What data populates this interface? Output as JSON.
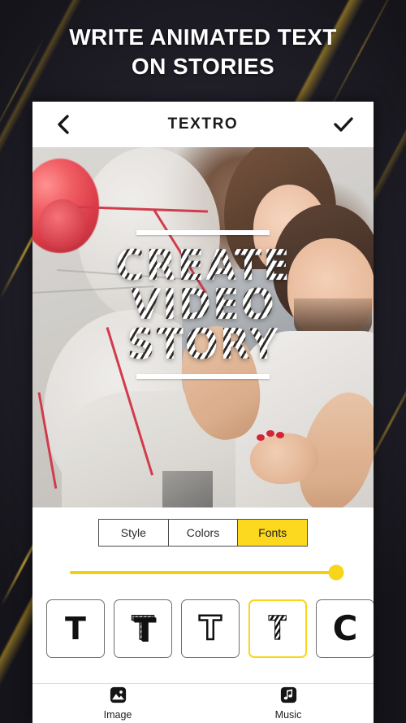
{
  "promo": {
    "headline_line1": "WRITE ANIMATED TEXT",
    "headline_line2": "ON STORIES",
    "background_color": "#1b1921",
    "accent_color": "#e1b937"
  },
  "appbar": {
    "back_icon": "chevron-left-icon",
    "title": "TEXTRO",
    "confirm_icon": "check-icon"
  },
  "canvas": {
    "overlay_line1": "CREATE",
    "overlay_line2": "VIDEO",
    "overlay_line3": "STORY",
    "divider_top": "horizontal-rule",
    "divider_bottom": "horizontal-rule",
    "photo_description": "couple with balloons"
  },
  "controls": {
    "tabs": [
      {
        "label": "Style",
        "active": false
      },
      {
        "label": "Colors",
        "active": false
      },
      {
        "label": "Fonts",
        "active": true
      }
    ],
    "active_tab": "Fonts",
    "accent_color": "#fcd81f",
    "slider": {
      "value": 100,
      "min": 0,
      "max": 100,
      "track_color": "#f3cf12",
      "thumb_color": "#f7d51a"
    },
    "fonts": [
      {
        "glyph": "T",
        "style": "plain",
        "selected": false
      },
      {
        "glyph": "T",
        "style": "shaded",
        "selected": false
      },
      {
        "glyph": "T",
        "style": "dotted",
        "selected": false
      },
      {
        "glyph": "T",
        "style": "striped",
        "selected": true
      },
      {
        "glyph": "C",
        "style": "round",
        "selected": false
      }
    ]
  },
  "bottom_nav": [
    {
      "label": "Image",
      "icon": "image-icon"
    },
    {
      "label": "Music",
      "icon": "music-note-icon"
    }
  ]
}
